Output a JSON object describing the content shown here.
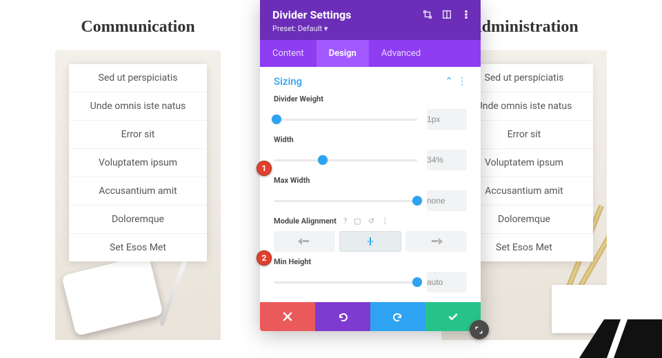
{
  "columns": {
    "left": {
      "title": "Communication",
      "items": [
        "Sed ut perspiciatis",
        "Unde omnis iste natus",
        "Error sit",
        "Voluptatem ipsum",
        "Accusantium amit",
        "Doloremque",
        "Set Esos Met"
      ]
    },
    "right": {
      "title": "Administration",
      "items": [
        "Sed ut perspiciatis",
        "Unde omnis iste natus",
        "Error sit",
        "Voluptatem ipsum",
        "Accusantium amit",
        "Doloremque",
        "Set Esos Met"
      ]
    }
  },
  "modal": {
    "title": "Divider Settings",
    "preset": "Preset: Default ▾",
    "tabs": {
      "content": "Content",
      "design": "Design",
      "advanced": "Advanced",
      "active": "design"
    },
    "section": {
      "title": "Sizing"
    },
    "fields": {
      "weight": {
        "label": "Divider Weight",
        "value": "1px",
        "pct": 2
      },
      "width": {
        "label": "Width",
        "value": "34%",
        "pct": 34
      },
      "maxwidth": {
        "label": "Max Width",
        "value": "none",
        "pct": 100
      },
      "align": {
        "label": "Module Alignment",
        "value": "center"
      },
      "minheight": {
        "label": "Min Height",
        "value": "auto",
        "pct": 100
      }
    }
  },
  "callouts": {
    "1": "1",
    "2": "2"
  },
  "colors": {
    "accent": "#2ea3f2",
    "brand": "#6c2eb9"
  }
}
